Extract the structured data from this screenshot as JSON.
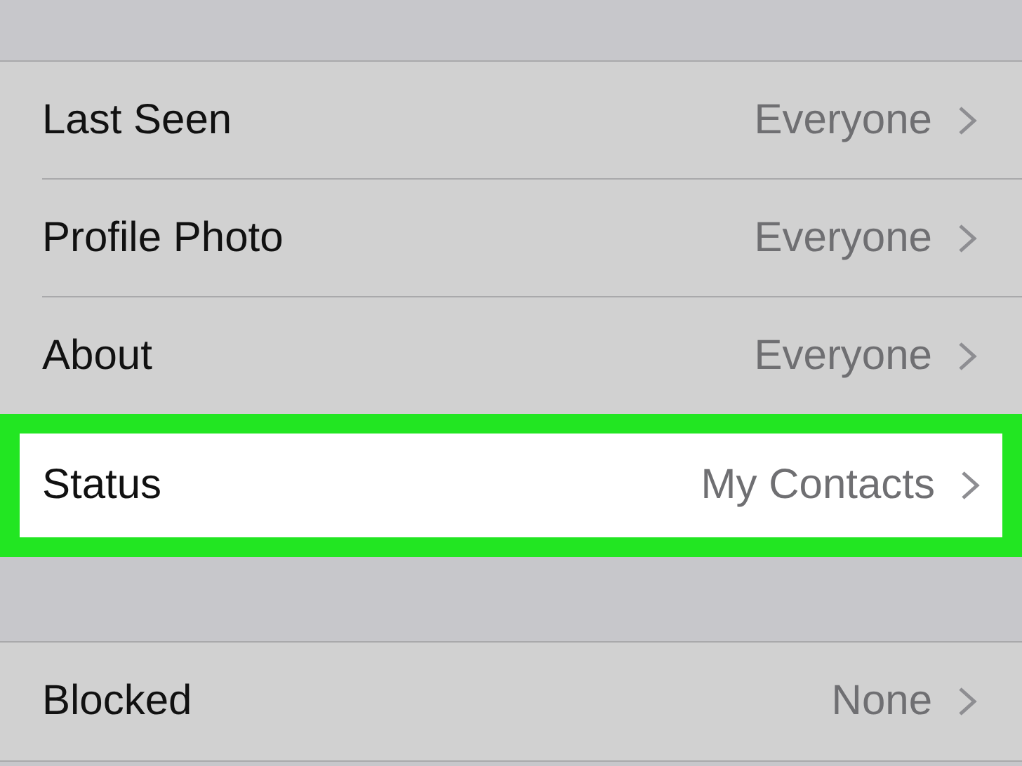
{
  "sections": [
    {
      "rows": [
        {
          "label": "Last Seen",
          "value": "Everyone",
          "highlighted": false
        },
        {
          "label": "Profile Photo",
          "value": "Everyone",
          "highlighted": false
        },
        {
          "label": "About",
          "value": "Everyone",
          "highlighted": false
        },
        {
          "label": "Status",
          "value": "My Contacts",
          "highlighted": true
        }
      ]
    },
    {
      "rows": [
        {
          "label": "Blocked",
          "value": "None",
          "highlighted": false
        }
      ]
    }
  ]
}
